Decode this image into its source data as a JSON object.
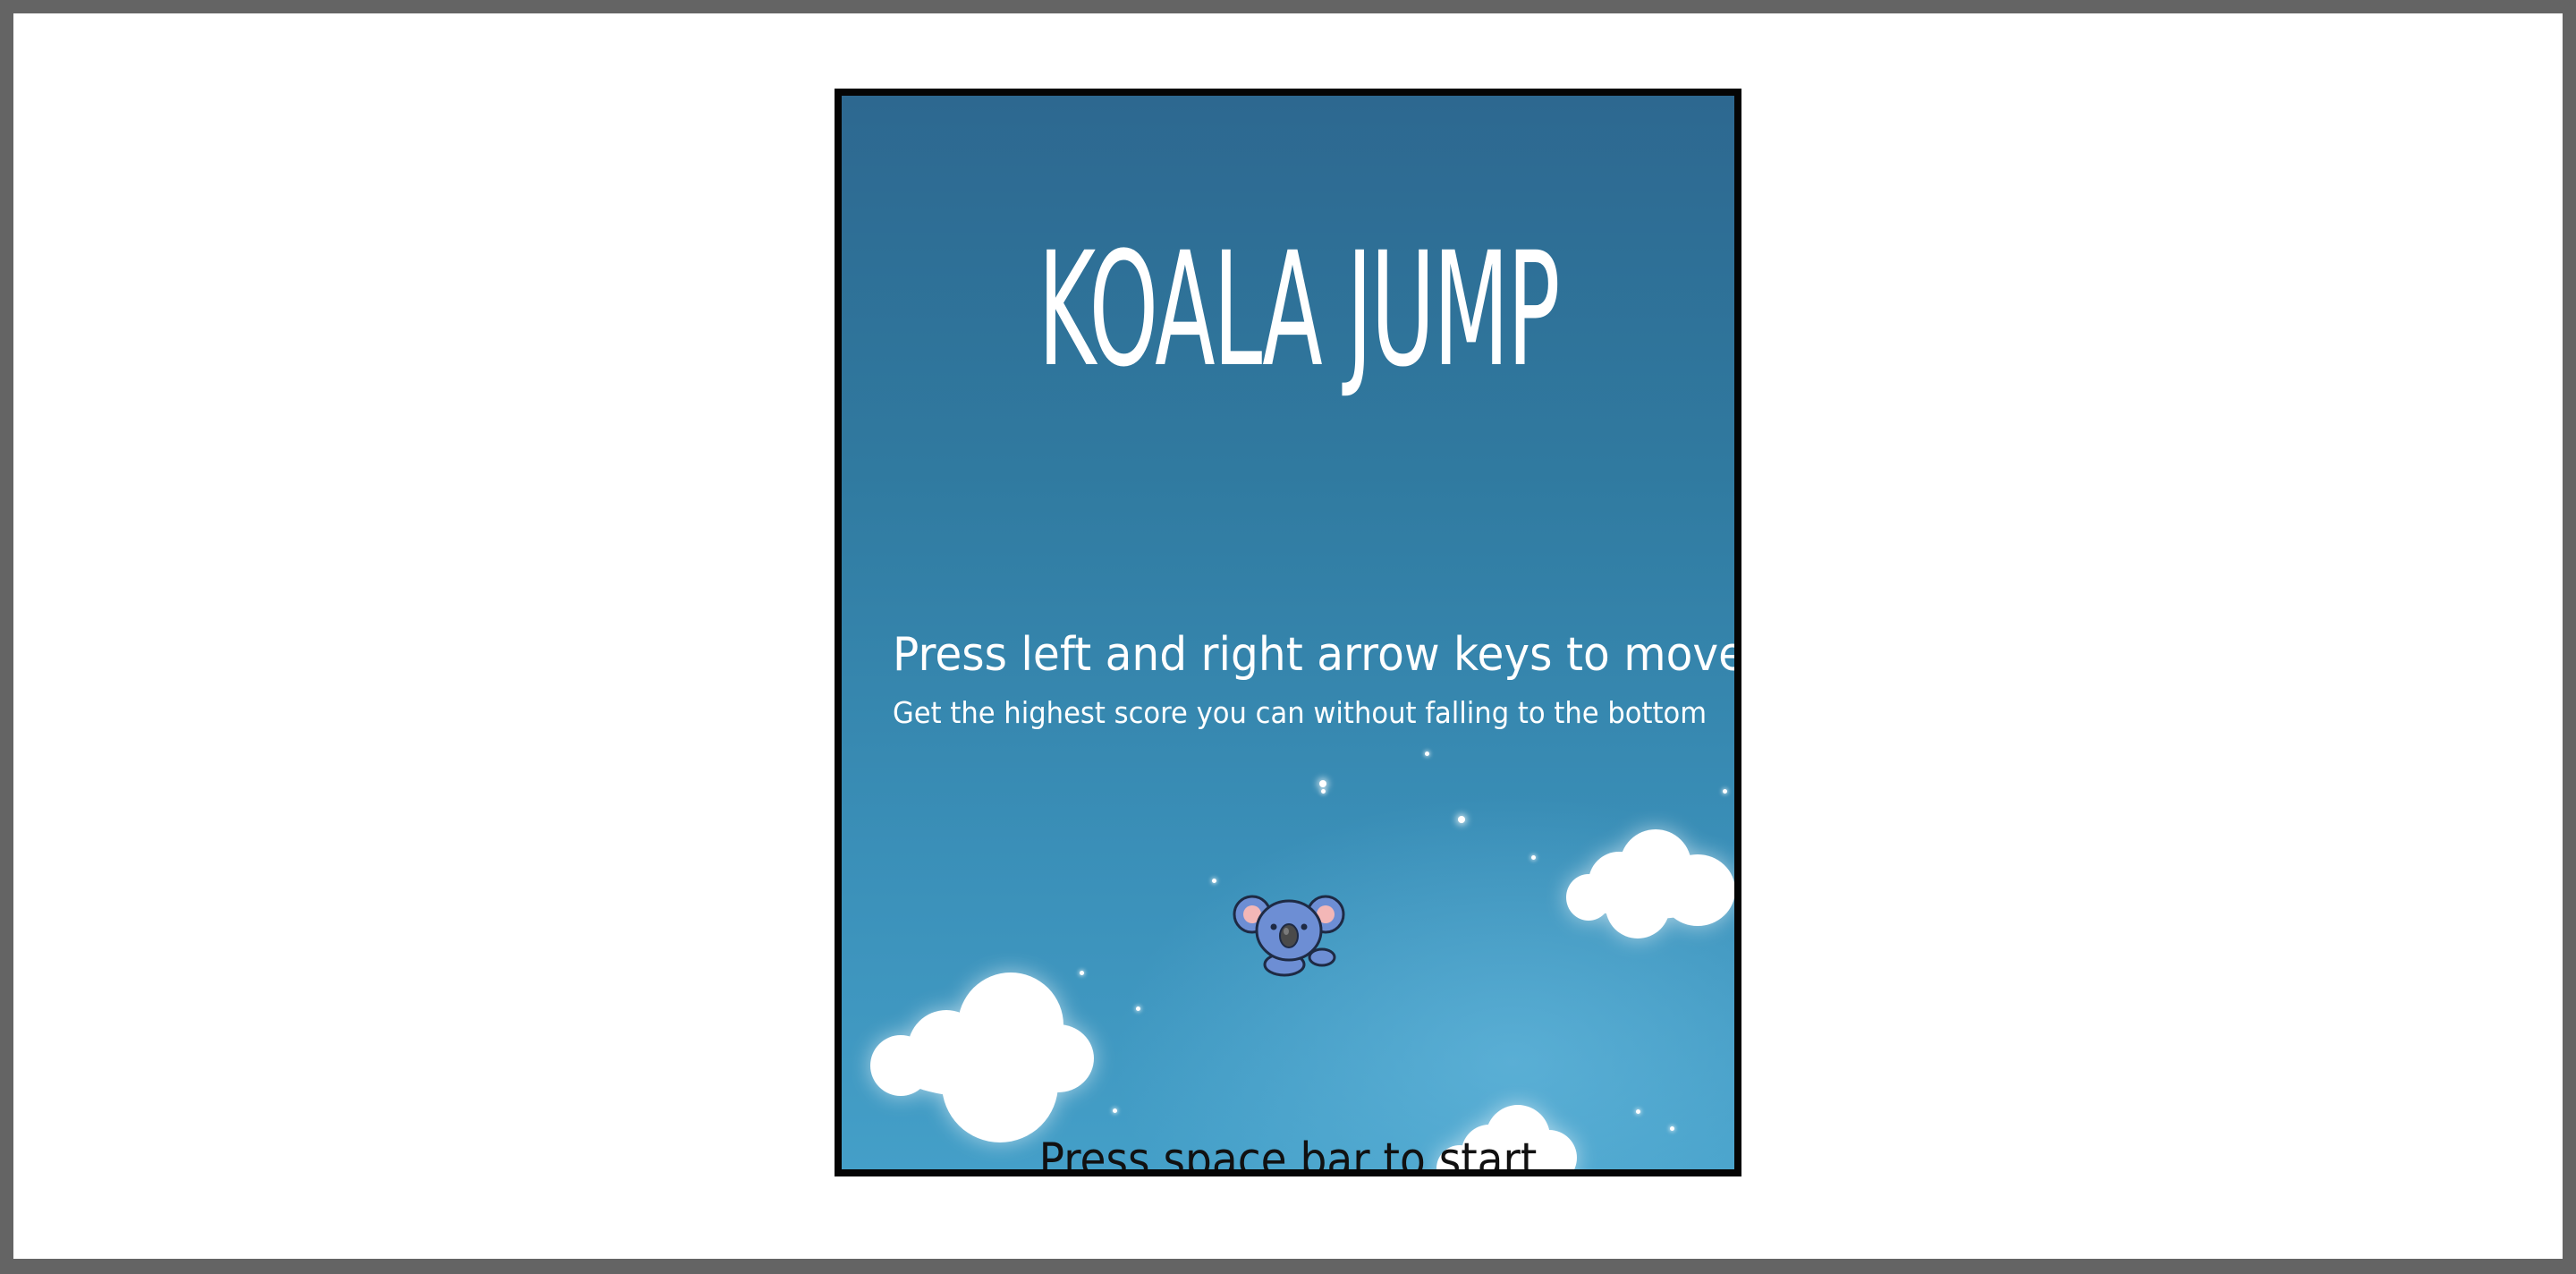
{
  "game": {
    "title": "KOALA JUMP",
    "instructions": {
      "main": "Press left and right arrow keys to move",
      "sub": "Get the highest score you can without falling to the bottom"
    },
    "start_prompt": "Press space bar to start"
  },
  "colors": {
    "sky_top": "#2d6890",
    "sky_bottom": "#449fc8",
    "text": "#ffffff",
    "prompt_text": "#111111",
    "frame_border": "#050505",
    "koala_body": "#6d8ed4",
    "koala_ear_inner": "#f3b7b7",
    "koala_nose": "#4a4a4a"
  },
  "icons": {
    "player": "koala-icon",
    "clouds": "cloud-icon",
    "stars": "star-icon"
  }
}
